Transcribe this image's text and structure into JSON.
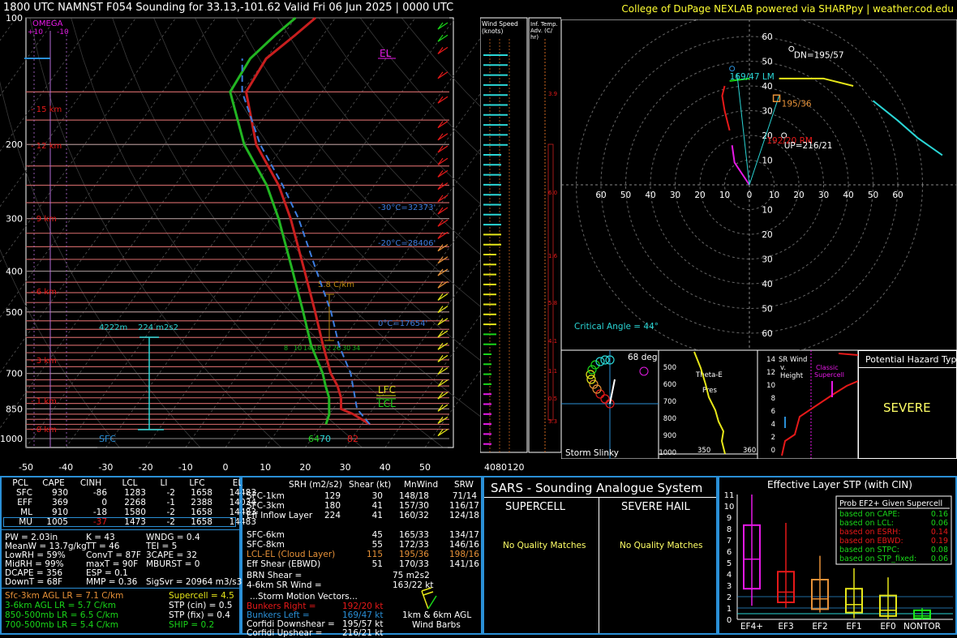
{
  "header": {
    "left": "1800 UTC NAMNST F054 Sounding for 33.13,-101.62 Valid  Fri 06 Jun 2025 | 0000 UTC",
    "right": "College of DuPage NEXLAB powered via SHARPpy | weather.cod.edu"
  },
  "skewt": {
    "omega_label": "OMEGA",
    "omega_ticks": [
      "+10",
      "-10"
    ],
    "pressure_labels": [
      "100",
      "200",
      "300",
      "400",
      "500",
      "700",
      "850",
      "1000"
    ],
    "temp_labels": [
      "-50",
      "-40",
      "-30",
      "-20",
      "-10",
      "0",
      "10",
      "20",
      "30",
      "40",
      "50"
    ],
    "height_labels": [
      "15 km",
      "12 km",
      "9 km",
      "6 km",
      "3 km",
      "1 km",
      "0 km"
    ],
    "el": "EL",
    "lfc": "LFC",
    "lcl": "LCL",
    "sfc": "SFC",
    "isotherm_labels": [
      "-30°C=32373'",
      "-20°C=28406'",
      "0°C=17654'"
    ],
    "lapse_box": "5.8 C/km",
    "eff_depth": "4222m",
    "eff_srh": "224 m2s2",
    "surface_values": [
      "64",
      "70",
      "82"
    ],
    "wetbulb_labels": [
      "8",
      "10",
      "14",
      "18",
      "22",
      "26",
      "30",
      "34"
    ]
  },
  "chart_data": {
    "type": "line",
    "title": "1800 UTC NAMNST F054 Sounding for 33.13,-101.62 Valid  Fri 06 Jun 2025 | 0000 UTC",
    "xlabel": "",
    "ylabel": "",
    "xlim": [
      -50,
      50
    ],
    "ylim": [
      1050,
      100
    ],
    "y_scale": "log",
    "skew": true,
    "series": [
      {
        "name": "",
        "color": "#c81e1e",
        "points": [
          [
            32,
            925
          ],
          [
            26,
            875
          ],
          [
            22,
            850
          ],
          [
            20,
            800
          ],
          [
            17,
            750
          ],
          [
            13,
            700
          ],
          [
            6,
            600
          ],
          [
            -2,
            500
          ],
          [
            -12,
            400
          ],
          [
            -25,
            300
          ],
          [
            -34,
            250
          ],
          [
            -47,
            200
          ],
          [
            -59,
            150
          ],
          [
            -60,
            125
          ],
          [
            -57,
            110
          ],
          [
            -55,
            100
          ]
        ]
      },
      {
        "name": "",
        "color": "#22b522",
        "points": [
          [
            21,
            925
          ],
          [
            20,
            875
          ],
          [
            19,
            850
          ],
          [
            17,
            800
          ],
          [
            14,
            750
          ],
          [
            11,
            700
          ],
          [
            3,
            600
          ],
          [
            -5,
            500
          ],
          [
            -15,
            400
          ],
          [
            -28,
            300
          ],
          [
            -37,
            250
          ],
          [
            -50,
            200
          ],
          [
            -63,
            150
          ],
          [
            -64,
            125
          ],
          [
            -62,
            110
          ],
          [
            -60,
            100
          ]
        ]
      },
      {
        "name": "",
        "color": "#3c7de0",
        "points": [
          [
            32,
            925
          ],
          [
            26,
            850
          ],
          [
            18,
            700
          ],
          [
            10,
            600
          ],
          [
            2,
            500
          ],
          [
            -9,
            400
          ],
          [
            -23,
            300
          ],
          [
            -33,
            250
          ],
          [
            -46,
            200
          ],
          [
            -60,
            150
          ],
          [
            -66,
            125
          ]
        ]
      }
    ]
  },
  "wind_speed": {
    "title": "Wind Speed (knots)",
    "ticks": [
      "40",
      "80",
      "120"
    ]
  },
  "inf_temp": {
    "title": "Inf. Temp. Adv. (C/hr)",
    "values": [
      "3.9",
      "6.0",
      "1.6",
      "5.8",
      "4.1",
      "1.1",
      "0.5",
      "3.3"
    ]
  },
  "hodograph": {
    "ring_labels": [
      "60",
      "50",
      "40",
      "30",
      "20",
      "10"
    ],
    "axis_labels": [
      "60",
      "50",
      "40",
      "30",
      "20",
      "10",
      "0",
      "10",
      "20",
      "30",
      "40",
      "50",
      "60"
    ],
    "lower_ring_labels": [
      "10",
      "20",
      "30",
      "40",
      "50",
      "60"
    ],
    "dn": "DN=195/57",
    "lm": "169/47 LM",
    "mw": "195/36",
    "rm": "192/20 RM",
    "up": "UP=216/21",
    "critical_angle": "Critical Angle = 44°"
  },
  "slinky": {
    "title": "Storm Slinky",
    "deg": "68 deg"
  },
  "theta_e": {
    "label1": "Theta-E",
    "label2": "Pres",
    "y_ticks": [
      "500",
      "600",
      "700",
      "800",
      "900",
      "1000"
    ],
    "x_ticks": [
      "350",
      "360"
    ]
  },
  "sr_wind": {
    "title": "SR Wind v. Height",
    "classic": "Classic Supercell",
    "y_ticks": [
      "14",
      "12",
      "10",
      "8",
      "6",
      "4",
      "2",
      "0"
    ]
  },
  "hazard": {
    "title": "Potential Hazard Type",
    "value": "SEVERE"
  },
  "parcels": {
    "headers": [
      "PCL",
      "CAPE",
      "CINH",
      "LCL",
      "LI",
      "LFC",
      "EL"
    ],
    "rows": [
      [
        "SFC",
        "930",
        "-86",
        "1283",
        "-2",
        "1658",
        "14483"
      ],
      [
        "EFF",
        "369",
        "0",
        "2268",
        "-1",
        "2388",
        "14034"
      ],
      [
        "ML",
        "910",
        "-18",
        "1580",
        "-2",
        "1658",
        "14483"
      ],
      [
        "MU",
        "1005",
        "-37",
        "1473",
        "-2",
        "1658",
        "14483"
      ]
    ]
  },
  "indices": {
    "col1": [
      "PW = 2.03in",
      "MeanW = 13.7g/kg",
      "LowRH = 59%",
      "MidRH = 99%",
      "DCAPE = 356",
      "DownT = 68F"
    ],
    "col2": [
      "K = 43",
      "TT = 46",
      "ConvT = 87F",
      "maxT = 90F",
      "ESP = 0.1",
      "MMP = 0.36"
    ],
    "col3": [
      "WNDG = 0.4",
      "TEI = 5",
      "3CAPE = 32",
      "MBURST = 0",
      "",
      "SigSvr = 20964 m3/s3"
    ]
  },
  "lapse": [
    "Sfc-3km AGL LR = 7.1 C/km",
    "3-6km AGL LR = 5.7 C/km",
    "850-500mb LR = 6.5 C/km",
    "700-500mb LR = 5.4 C/km"
  ],
  "composites": [
    "Supercell = 4.5",
    "STP (cin) = 0.5",
    "STP (fix) = 0.4",
    "SHIP = 0.2"
  ],
  "kinematics": {
    "headers": [
      "SRH (m2/s2)",
      "Shear (kt)",
      "MnWind",
      "SRW"
    ],
    "rows": [
      [
        "SFC-1km",
        "129",
        "30",
        "148/18",
        "71/14"
      ],
      [
        "SFC-3km",
        "180",
        "41",
        "157/30",
        "116/17"
      ],
      [
        "Eff Inflow Layer",
        "224",
        "41",
        "160/32",
        "124/18"
      ],
      [
        "",
        "",
        "",
        "",
        ""
      ],
      [
        "SFC-6km",
        "",
        "45",
        "165/33",
        "134/17"
      ],
      [
        "SFC-8km",
        "",
        "55",
        "172/33",
        "146/16"
      ],
      [
        "LCL-EL (Cloud Layer)",
        "",
        "115",
        "195/36",
        "198/16"
      ],
      [
        "Eff Shear (EBWD)",
        "",
        "51",
        "170/33",
        "141/16"
      ]
    ],
    "brn": [
      "BRN Shear =",
      "75 m2s2"
    ],
    "srw46": [
      "4-6km SR Wind =",
      "163/22 kt"
    ],
    "storm_title": "...Storm Motion Vectors...",
    "storm": [
      [
        "Bunkers Right =",
        "192/20 kt"
      ],
      [
        "Bunkers Left =",
        "169/47 kt"
      ],
      [
        "Corfidi Downshear =",
        "195/57 kt"
      ],
      [
        "Corfidi Upshear =",
        "216/21 kt"
      ]
    ],
    "barb_caption": [
      "1km & 6km AGL",
      "Wind Barbs"
    ]
  },
  "sars": {
    "title": "SARS - Sounding Analogue System",
    "supercell": "SUPERCELL",
    "hail": "SEVERE HAIL",
    "sc_result": "No Quality Matches",
    "hail_result": "No Quality Matches"
  },
  "stp": {
    "title": "Effective Layer STP (with CIN)",
    "categories": [
      "EF4+",
      "EF3",
      "EF2",
      "EF1",
      "EF0",
      "NONTOR"
    ],
    "y_ticks": [
      "11",
      "10",
      "9",
      "8",
      "7",
      "6",
      "5",
      "4",
      "3",
      "2",
      "1",
      "0"
    ],
    "legend_title": "Prob EF2+ Given Supercell",
    "legend": [
      [
        "based on CAPE:",
        "0.16"
      ],
      [
        "based on LCL:",
        "0.06"
      ],
      [
        "based on ESRH:",
        "0.14"
      ],
      [
        "based on EBWD:",
        "0.19"
      ],
      [
        "based on STPC:",
        "0.08"
      ],
      [
        "based on STP_fixed:",
        "0.06"
      ]
    ],
    "boxes": [
      {
        "name": "EF4+",
        "min": 1.2,
        "q1": 2.7,
        "med": 5.3,
        "q3": 8.3,
        "max": 11.0,
        "color": "#e619e6"
      },
      {
        "name": "EF3",
        "min": 1.0,
        "q1": 1.5,
        "med": 2.4,
        "q3": 4.2,
        "max": 8.5,
        "color": "#e61919"
      },
      {
        "name": "EF2",
        "min": 0.6,
        "q1": 0.9,
        "med": 1.8,
        "q3": 3.5,
        "max": 5.6,
        "color": "#e69138"
      },
      {
        "name": "EF1",
        "min": 0.1,
        "q1": 0.6,
        "med": 1.3,
        "q3": 2.7,
        "max": 4.5,
        "color": "#e6e619"
      },
      {
        "name": "EF0",
        "min": 0.0,
        "q1": 0.3,
        "med": 0.8,
        "q3": 2.1,
        "max": 3.7,
        "color": "#e6e619"
      },
      {
        "name": "NONTOR",
        "min": 0.0,
        "q1": 0.1,
        "med": 0.3,
        "q3": 0.8,
        "max": 1.0,
        "color": "#19e619"
      }
    ],
    "current": 0.5
  }
}
